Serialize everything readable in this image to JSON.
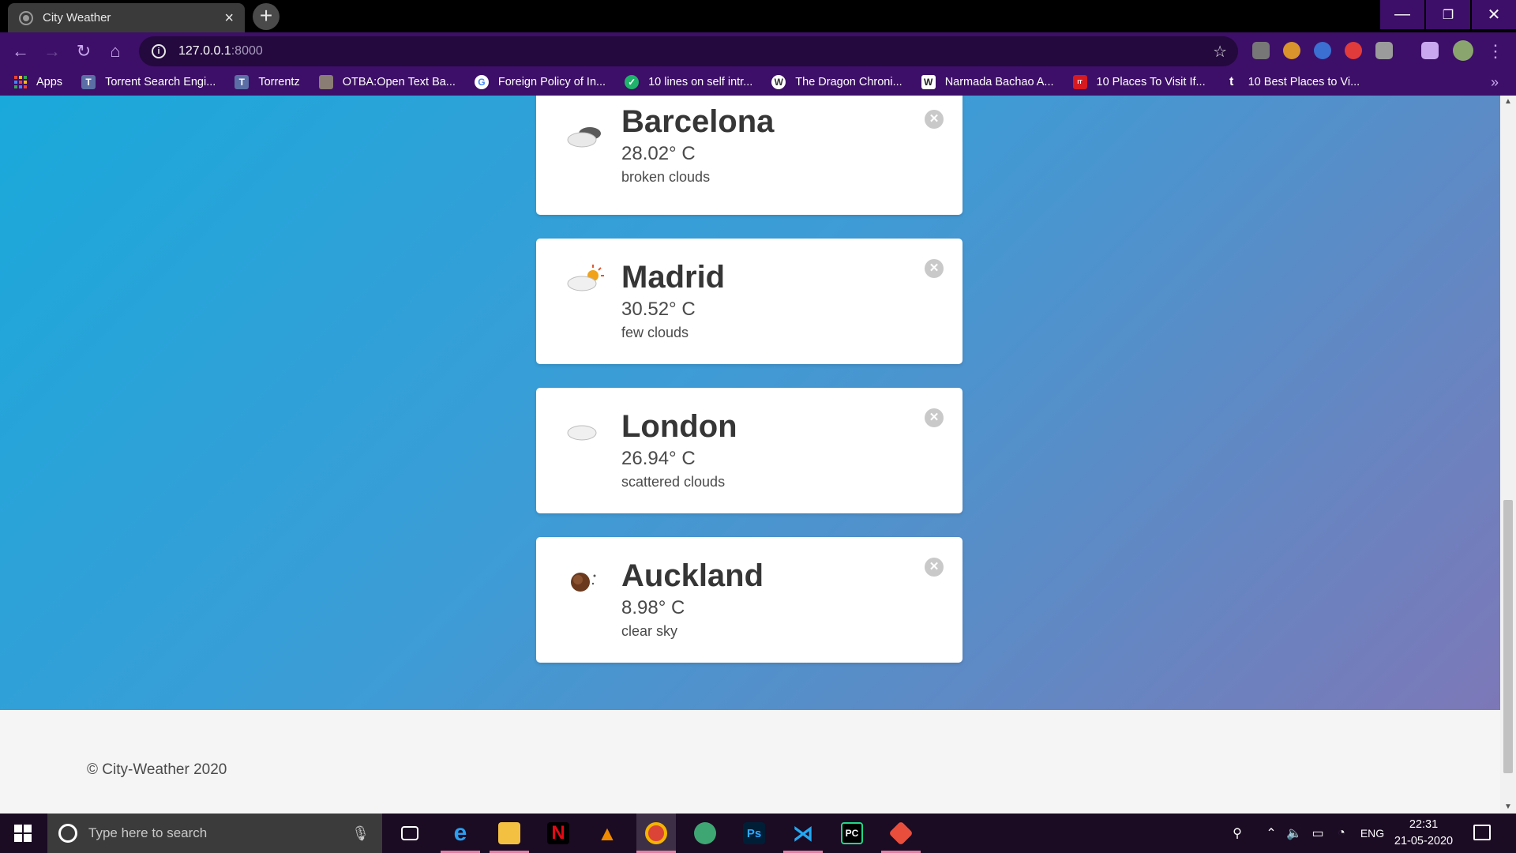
{
  "browser": {
    "tab_title": "City Weather",
    "tab_close": "×",
    "new_tab": "+",
    "url_host": "127.0.0.1",
    "url_port": ":8000",
    "window_controls": {
      "minimize": "—",
      "restore": "❐",
      "close": "✕"
    }
  },
  "bookmarks": [
    {
      "label": "Apps",
      "icon": "apps-grid-icon"
    },
    {
      "label": "Torrent Search Engi...",
      "icon": "torrent-t-icon"
    },
    {
      "label": "Torrentz",
      "icon": "torrent-t-icon"
    },
    {
      "label": "OTBA:Open Text Ba...",
      "icon": "photo-icon"
    },
    {
      "label": "Foreign Policy of In...",
      "icon": "google-icon"
    },
    {
      "label": "10 lines on self intr...",
      "icon": "check-icon"
    },
    {
      "label": "The Dragon Chroni...",
      "icon": "wordpress-icon"
    },
    {
      "label": "Narmada Bachao A...",
      "icon": "wikipedia-icon"
    },
    {
      "label": "10 Places To Visit If...",
      "icon": "indiatimes-icon"
    },
    {
      "label": "10 Best Places to Vi...",
      "icon": "tumblr-icon"
    }
  ],
  "cards": [
    {
      "city": "Barcelona",
      "temp": "28.02° C",
      "desc": "broken clouds",
      "icon": "broken-clouds-icon"
    },
    {
      "city": "Madrid",
      "temp": "30.52° C",
      "desc": "few clouds",
      "icon": "few-clouds-icon"
    },
    {
      "city": "London",
      "temp": "26.94° C",
      "desc": "scattered clouds",
      "icon": "scattered-clouds-icon"
    },
    {
      "city": "Auckland",
      "temp": "8.98° C",
      "desc": "clear sky",
      "icon": "clear-sky-night-icon"
    }
  ],
  "footer": {
    "text": "© City-Weather 2020"
  },
  "taskbar": {
    "search_placeholder": "Type here to search",
    "language": "ENG",
    "time": "22:31",
    "date": "21-05-2020"
  },
  "colors": {
    "chrome": "#3d0f68",
    "hero_start": "#1aa9db",
    "hero_end": "#7d78b8",
    "card": "#ffffff",
    "taskbar": "#1b0b23"
  }
}
